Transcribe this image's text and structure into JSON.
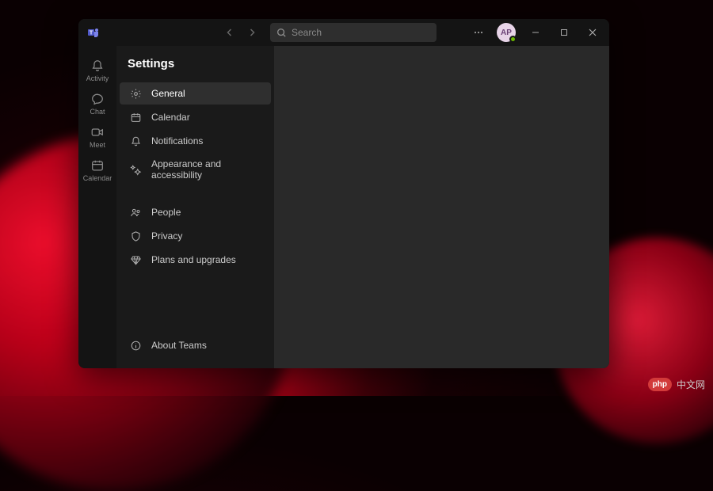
{
  "titlebar": {
    "search_placeholder": "Search",
    "avatar_initials": "AP"
  },
  "rail": {
    "items": [
      {
        "label": "Activity",
        "icon": "bell"
      },
      {
        "label": "Chat",
        "icon": "chat"
      },
      {
        "label": "Meet",
        "icon": "video"
      },
      {
        "label": "Calendar",
        "icon": "calendar"
      }
    ]
  },
  "settings": {
    "title": "Settings",
    "group1": [
      {
        "label": "General",
        "icon": "gear",
        "selected": true
      },
      {
        "label": "Calendar",
        "icon": "calendar",
        "selected": false
      },
      {
        "label": "Notifications",
        "icon": "bell",
        "selected": false
      },
      {
        "label": "Appearance and accessibility",
        "icon": "sparkle",
        "selected": false
      }
    ],
    "group2": [
      {
        "label": "People",
        "icon": "people",
        "selected": false
      },
      {
        "label": "Privacy",
        "icon": "shield",
        "selected": false
      },
      {
        "label": "Plans and upgrades",
        "icon": "diamond",
        "selected": false
      }
    ],
    "footer": {
      "label": "About Teams",
      "icon": "info"
    }
  },
  "watermark": {
    "badge": "php",
    "text": "中文网"
  }
}
